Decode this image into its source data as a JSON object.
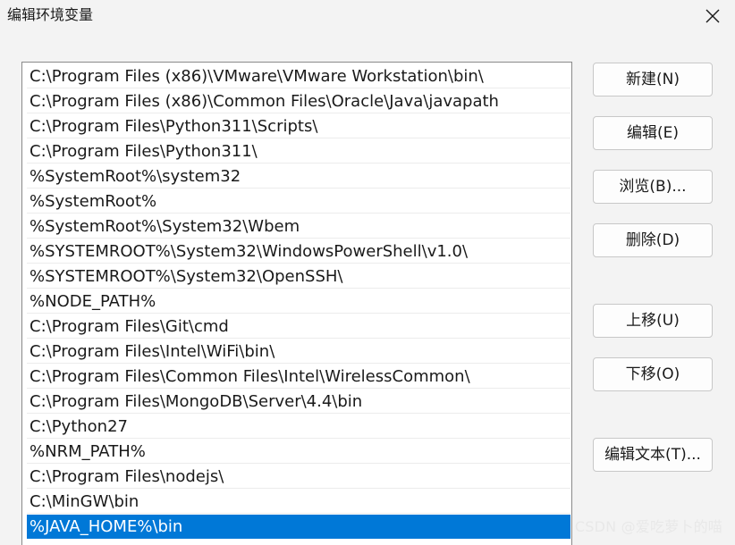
{
  "window": {
    "title": "编辑环境变量"
  },
  "paths": [
    "C:\\Program Files (x86)\\VMware\\VMware Workstation\\bin\\",
    "C:\\Program Files (x86)\\Common Files\\Oracle\\Java\\javapath",
    "C:\\Program Files\\Python311\\Scripts\\",
    "C:\\Program Files\\Python311\\",
    "%SystemRoot%\\system32",
    "%SystemRoot%",
    "%SystemRoot%\\System32\\Wbem",
    "%SYSTEMROOT%\\System32\\WindowsPowerShell\\v1.0\\",
    "%SYSTEMROOT%\\System32\\OpenSSH\\",
    "%NODE_PATH%",
    "C:\\Program Files\\Git\\cmd",
    "C:\\Program Files\\Intel\\WiFi\\bin\\",
    "C:\\Program Files\\Common Files\\Intel\\WirelessCommon\\",
    "C:\\Program Files\\MongoDB\\Server\\4.4\\bin",
    "C:\\Python27",
    "%NRM_PATH%",
    "C:\\Program Files\\nodejs\\",
    "C:\\MinGW\\bin",
    "%JAVA_HOME%\\bin"
  ],
  "selected_index": 18,
  "buttons": {
    "new": "新建(N)",
    "edit": "编辑(E)",
    "browse": "浏览(B)...",
    "delete": "删除(D)",
    "move_up": "上移(U)",
    "move_down": "下移(O)",
    "edit_text": "编辑文本(T)..."
  },
  "icons": {
    "close": "close-icon"
  },
  "colors": {
    "selection": "#0078d7",
    "background": "#f3f3f3"
  },
  "watermark": "CSDN @爱吃萝卜的喵"
}
